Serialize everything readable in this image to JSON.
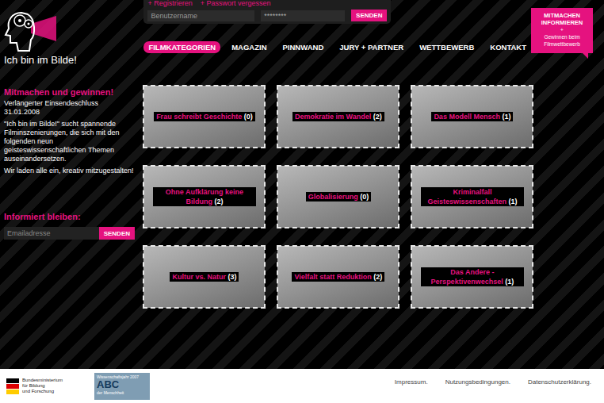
{
  "logo": {
    "text": "Ich bin im Bilde!"
  },
  "login": {
    "links": [
      "+ Registrieren",
      "+ Passwort vergessen"
    ],
    "username_placeholder": "Benutzername",
    "password_value": "********",
    "button": "SENDEN"
  },
  "promo": [
    "MITMACHEN",
    "INFORMIEREN",
    "+",
    "Gewinnen beim",
    "Filmwettbewerb"
  ],
  "nav": [
    {
      "label": "FILMKATEGORIEN",
      "selected": true
    },
    {
      "label": "MAGAZIN",
      "selected": false
    },
    {
      "label": "PINNWAND",
      "selected": false
    },
    {
      "label": "JURY + PARTNER",
      "selected": false
    },
    {
      "label": "WETTBEWERB",
      "selected": false
    },
    {
      "label": "KONTAKT",
      "selected": false
    }
  ],
  "intro": {
    "title": "Mitmachen und gewinnen!",
    "deadline": "Verlängerter Einsendeschluss 31.01.2008",
    "paragraphs": [
      "\"Ich bin im Bilde!\" sucht spannende Filminszenierungen, die sich mit den folgenden neun geisteswissenschaftlichen Themen auseinandersetzen.",
      "Wir laden alle ein, kreativ mitzugestalten!"
    ]
  },
  "newsletter": {
    "title": "Informiert bleiben:",
    "placeholder": "Emailadresse",
    "button": "SENDEN"
  },
  "categories": [
    {
      "title": "Frau schreibt Geschichte",
      "count": "(0)"
    },
    {
      "title": "Demokratie im Wandel",
      "count": "(2)"
    },
    {
      "title": "Das Modell Mensch",
      "count": "(1)"
    },
    {
      "title": "Ohne Aufklärung keine Bildung",
      "count": "(2)"
    },
    {
      "title": "Globalisierung",
      "count": "(0)"
    },
    {
      "title": "Kriminalfall Geisteswissenschaften",
      "count": "(1)"
    },
    {
      "title": "Kultur vs. Natur",
      "count": "(3)"
    },
    {
      "title": "Vielfalt statt Reduktion",
      "count": "(2)"
    },
    {
      "title": "Das Andere - Perspektivenwechsel",
      "count": "(1)"
    }
  ],
  "footer": {
    "ministry": [
      "Bundesministerium",
      "für Bildung",
      "und Forschung"
    ],
    "year_badge": {
      "top": "Wissenschaftsjahr 2007",
      "big": "ABC",
      "sub": "der Menschheit"
    },
    "links": [
      "Impressum.",
      "Nutzungsbedingungen.",
      "Datenschutzerklärung."
    ]
  }
}
